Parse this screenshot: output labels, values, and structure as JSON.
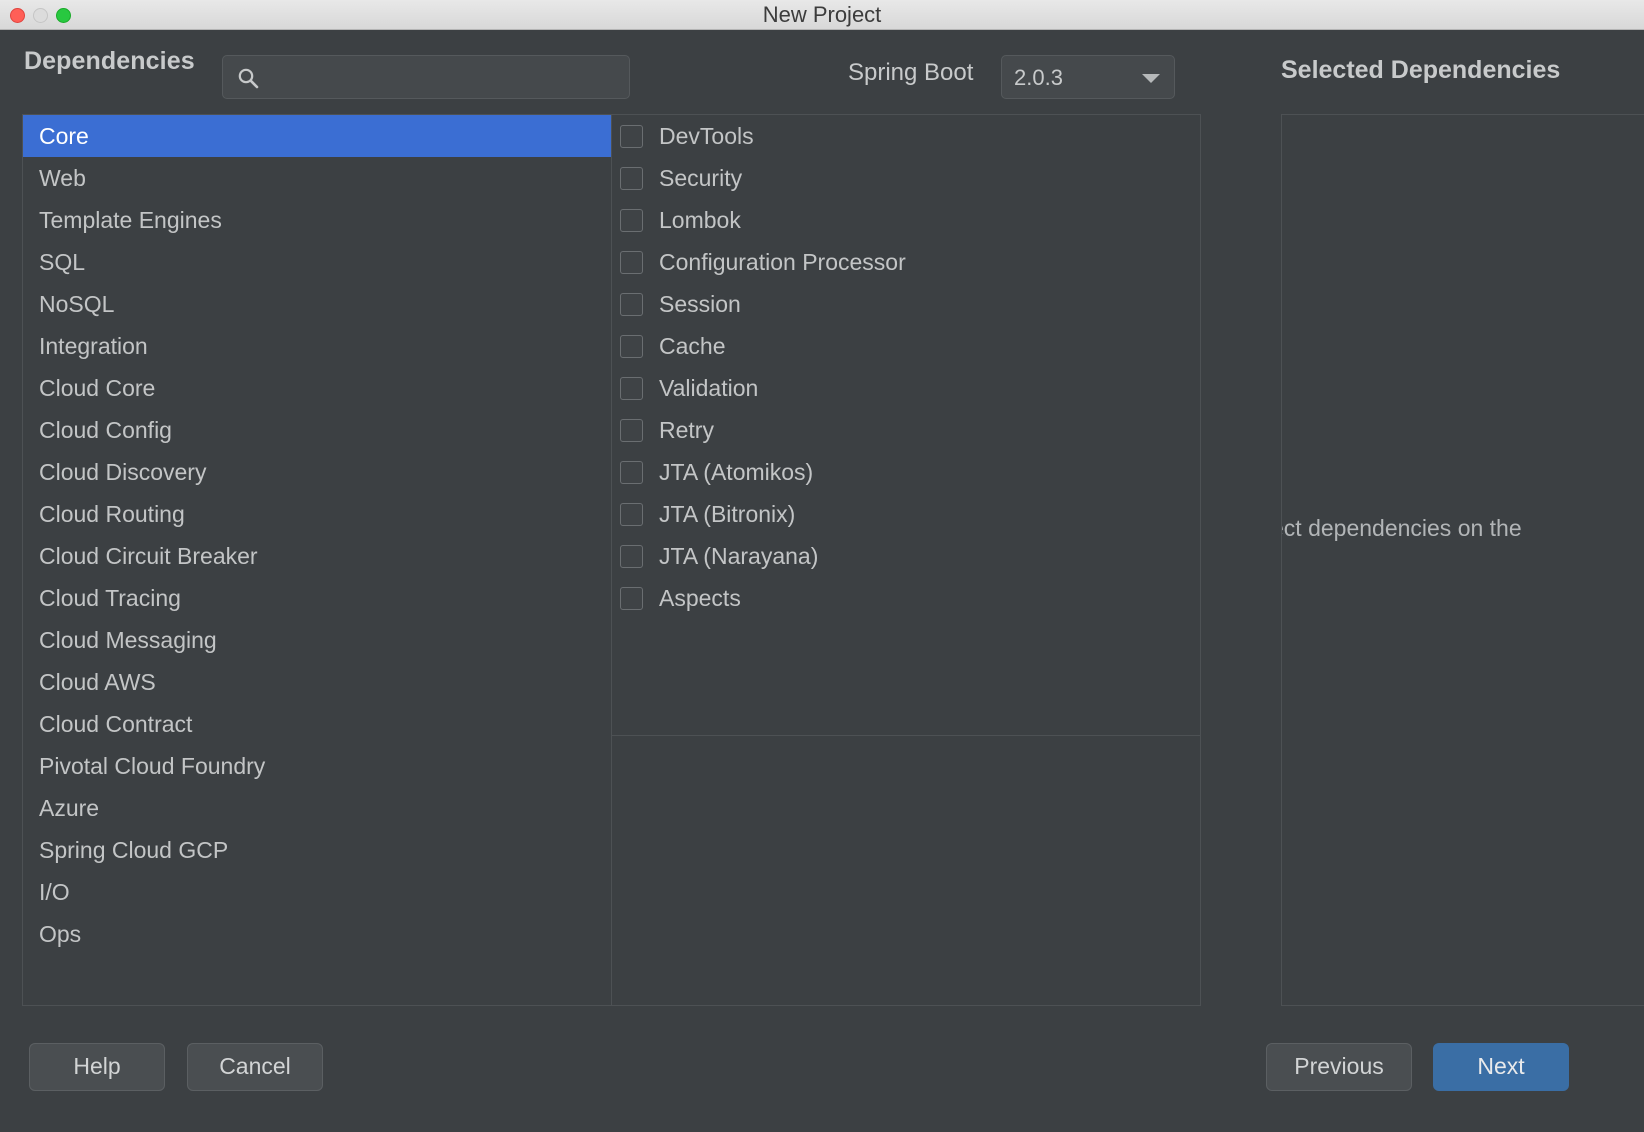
{
  "window": {
    "title": "New Project",
    "traffic_lights": [
      "close",
      "minimize",
      "zoom"
    ]
  },
  "header": {
    "dependencies_label": "Dependencies",
    "search": {
      "value": "",
      "placeholder": "",
      "icon": "search-icon"
    },
    "spring_boot_label": "Spring Boot",
    "spring_boot_version": "2.0.3",
    "spring_boot_options": [
      "2.0.3"
    ],
    "selected_dependencies_label": "Selected Dependencies"
  },
  "categories": {
    "selected_index": 0,
    "items": [
      {
        "label": "Core"
      },
      {
        "label": "Web"
      },
      {
        "label": "Template Engines"
      },
      {
        "label": "SQL"
      },
      {
        "label": "NoSQL"
      },
      {
        "label": "Integration"
      },
      {
        "label": "Cloud Core"
      },
      {
        "label": "Cloud Config"
      },
      {
        "label": "Cloud Discovery"
      },
      {
        "label": "Cloud Routing"
      },
      {
        "label": "Cloud Circuit Breaker"
      },
      {
        "label": "Cloud Tracing"
      },
      {
        "label": "Cloud Messaging"
      },
      {
        "label": "Cloud AWS"
      },
      {
        "label": "Cloud Contract"
      },
      {
        "label": "Pivotal Cloud Foundry"
      },
      {
        "label": "Azure"
      },
      {
        "label": "Spring Cloud GCP"
      },
      {
        "label": "I/O"
      },
      {
        "label": "Ops"
      }
    ]
  },
  "dependencies": {
    "items": [
      {
        "label": "DevTools",
        "checked": false
      },
      {
        "label": "Security",
        "checked": false
      },
      {
        "label": "Lombok",
        "checked": false
      },
      {
        "label": "Configuration Processor",
        "checked": false
      },
      {
        "label": "Session",
        "checked": false
      },
      {
        "label": "Cache",
        "checked": false
      },
      {
        "label": "Validation",
        "checked": false
      },
      {
        "label": "Retry",
        "checked": false
      },
      {
        "label": "JTA (Atomikos)",
        "checked": false
      },
      {
        "label": "JTA (Bitronix)",
        "checked": false
      },
      {
        "label": "JTA (Narayana)",
        "checked": false
      },
      {
        "label": "Aspects",
        "checked": false
      }
    ]
  },
  "selected_panel": {
    "hint_text": "ect dependencies on the",
    "items": []
  },
  "buttons": {
    "help": "Help",
    "cancel": "Cancel",
    "previous": "Previous",
    "next": "Next"
  },
  "colors": {
    "window_bg": "#3c4043",
    "titlebar_bg": "#e0e0e0",
    "selection_blue": "#3b6ed3",
    "accent_button_blue": "#3a6ea5",
    "text_primary": "#c3c5c6",
    "border": "#4d5154",
    "traffic_close": "#ff5f57",
    "traffic_min": "#dcdcdc",
    "traffic_zoom": "#28c840"
  }
}
